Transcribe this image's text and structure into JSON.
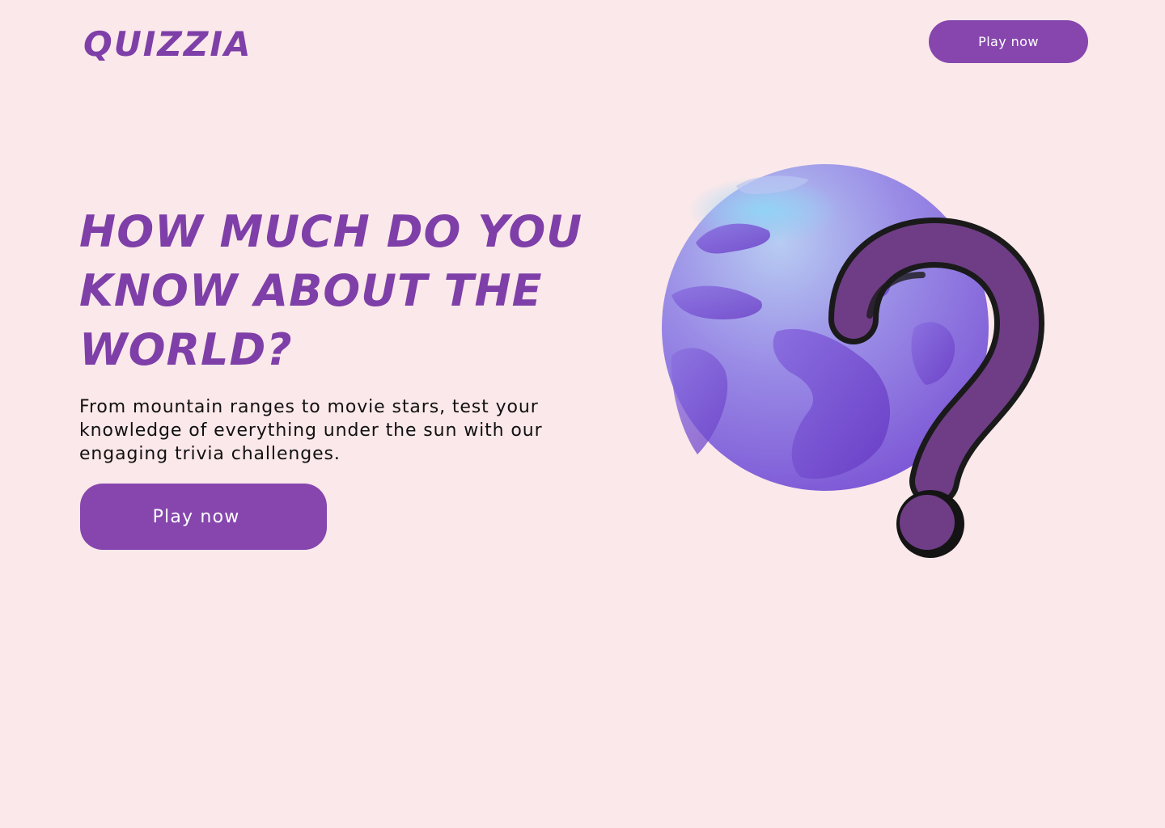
{
  "header": {
    "logo_text": "QUIZZIA",
    "cta_label": "Play now"
  },
  "hero": {
    "title": "How much do you know about the world?",
    "description": "From mountain ranges to movie stars, test your knowledge of everything under the sun with our engaging trivia challenges.",
    "cta_label": "Play now",
    "illustration": {
      "icon": "globe-question-mark-icon"
    }
  },
  "colors": {
    "background": "#fbe8ea",
    "brand_purple": "#7e3fa8",
    "button_purple": "#8646ae",
    "question_mark": "#6f3d86",
    "text_dark": "#111111"
  }
}
